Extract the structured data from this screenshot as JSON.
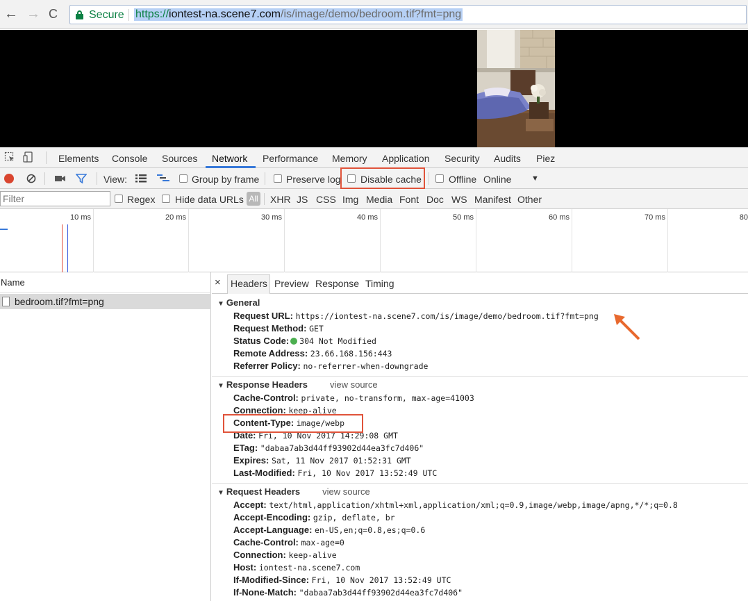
{
  "browser": {
    "secure_label": "Secure",
    "url_scheme": "https://",
    "url_host": "iontest-na.scene7.com",
    "url_path": "/is/image/demo/bedroom.tif?fmt=png",
    "back_icon": "←",
    "forward_icon": "→",
    "reload_icon": "C"
  },
  "devtools": {
    "tabs": [
      "Elements",
      "Console",
      "Sources",
      "Network",
      "Performance",
      "Memory",
      "Application",
      "Security",
      "Audits",
      "Piez"
    ],
    "active_tab": "Network",
    "toolbar": {
      "view_label": "View:",
      "group_by_frame": "Group by frame",
      "preserve_log": "Preserve log",
      "disable_cache": "Disable cache",
      "offline": "Offline",
      "throttle": "Online",
      "throttle_arrow": "▼"
    },
    "filter": {
      "placeholder": "Filter",
      "regex": "Regex",
      "hide_data_urls": "Hide data URLs",
      "all": "All",
      "types": [
        "XHR",
        "JS",
        "CSS",
        "Img",
        "Media",
        "Font",
        "Doc",
        "WS",
        "Manifest",
        "Other"
      ]
    },
    "timeline": {
      "ticks": [
        "10 ms",
        "20 ms",
        "30 ms",
        "40 ms",
        "50 ms",
        "60 ms",
        "70 ms",
        "80"
      ]
    },
    "requests": {
      "column_header": "Name",
      "items": [
        "bedroom.tif?fmt=png"
      ]
    },
    "detail": {
      "close": "×",
      "tabs": [
        "Headers",
        "Preview",
        "Response",
        "Timing"
      ],
      "active_tab": "Headers",
      "view_source": "view source",
      "general": {
        "title": "General",
        "rows": [
          {
            "key": "Request URL:",
            "value": "https://iontest-na.scene7.com/is/image/demo/bedroom.tif?fmt=png"
          },
          {
            "key": "Request Method:",
            "value": "GET"
          },
          {
            "key": "Status Code:",
            "value": "304 Not Modified"
          },
          {
            "key": "Remote Address:",
            "value": "23.66.168.156:443"
          },
          {
            "key": "Referrer Policy:",
            "value": "no-referrer-when-downgrade"
          }
        ]
      },
      "response_headers": {
        "title": "Response Headers",
        "rows": [
          {
            "key": "Cache-Control:",
            "value": "private, no-transform, max-age=41003"
          },
          {
            "key": "Connection:",
            "value": "keep-alive"
          },
          {
            "key": "Content-Type:",
            "value": "image/webp"
          },
          {
            "key": "Date:",
            "value": "Fri, 10 Nov 2017 14:29:08 GMT"
          },
          {
            "key": "ETag:",
            "value": "\"dabaa7ab3d44ff93902d44ea3fc7d406\""
          },
          {
            "key": "Expires:",
            "value": "Sat, 11 Nov 2017 01:52:31 GMT"
          },
          {
            "key": "Last-Modified:",
            "value": "Fri, 10 Nov 2017 13:52:49 UTC"
          }
        ]
      },
      "request_headers": {
        "title": "Request Headers",
        "rows": [
          {
            "key": "Accept:",
            "value": "text/html,application/xhtml+xml,application/xml;q=0.9,image/webp,image/apng,*/*;q=0.8"
          },
          {
            "key": "Accept-Encoding:",
            "value": "gzip, deflate, br"
          },
          {
            "key": "Accept-Language:",
            "value": "en-US,en;q=0.8,es;q=0.6"
          },
          {
            "key": "Cache-Control:",
            "value": "max-age=0"
          },
          {
            "key": "Connection:",
            "value": "keep-alive"
          },
          {
            "key": "Host:",
            "value": "iontest-na.scene7.com"
          },
          {
            "key": "If-Modified-Since:",
            "value": "Fri, 10 Nov 2017 13:52:49 UTC"
          },
          {
            "key": "If-None-Match:",
            "value": "\"dabaa7ab3d44ff93902d44ea3fc7d406\""
          }
        ]
      }
    }
  },
  "colors": {
    "highlight_box": "#e0533a",
    "arrow": "#e8692e",
    "secure_green": "#0b8043",
    "active_tab_underline": "#3879d9",
    "record_red": "#d9452f"
  }
}
